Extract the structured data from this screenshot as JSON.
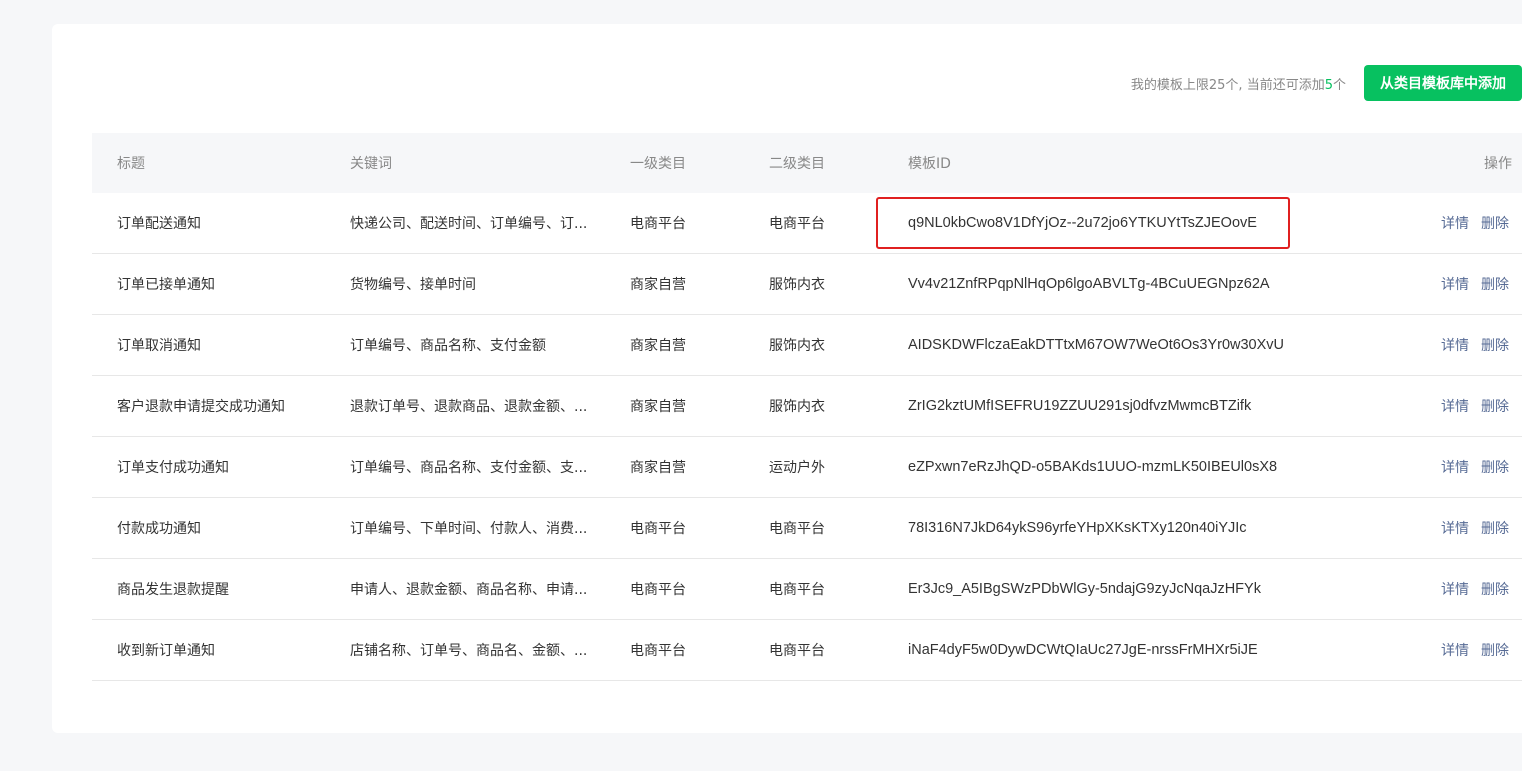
{
  "quota": {
    "prefix": "我的模板上限25个, 当前还可添加",
    "count": "5",
    "suffix": "个"
  },
  "add_button_label": "从类目模板库中添加",
  "columns": {
    "title": "标题",
    "keywords": "关键词",
    "level1": "一级类目",
    "level2": "二级类目",
    "template_id": "模板ID",
    "actions": "操作"
  },
  "rows": [
    {
      "title": "订单配送通知",
      "keywords": "快递公司、配送时间、订单编号、订...",
      "level1": "电商平台",
      "level2": "电商平台",
      "template_id": "q9NL0kbCwo8V1DfYjOz--2u72jo6YTKUYtTsZJEOovE",
      "detail": "详情",
      "delete": "删除"
    },
    {
      "title": "订单已接单通知",
      "keywords": "货物编号、接单时间",
      "level1": "商家自营",
      "level2": "服饰内衣",
      "template_id": "Vv4v21ZnfRPqpNlHqOp6lgoABVLTg-4BCuUEGNpz62A",
      "detail": "详情",
      "delete": "删除"
    },
    {
      "title": "订单取消通知",
      "keywords": "订单编号、商品名称、支付金额",
      "level1": "商家自营",
      "level2": "服饰内衣",
      "template_id": "AIDSKDWFlczaEakDTTtxM67OW7WeOt6Os3Yr0w30XvU",
      "detail": "详情",
      "delete": "删除"
    },
    {
      "title": "客户退款申请提交成功通知",
      "keywords": "退款订单号、退款商品、退款金额、...",
      "level1": "商家自营",
      "level2": "服饰内衣",
      "template_id": "ZrIG2kztUMfISEFRU19ZZUU291sj0dfvzMwmcBTZifk",
      "detail": "详情",
      "delete": "删除"
    },
    {
      "title": "订单支付成功通知",
      "keywords": "订单编号、商品名称、支付金额、支...",
      "level1": "商家自营",
      "level2": "运动户外",
      "template_id": "eZPxwn7eRzJhQD-o5BAKds1UUO-mzmLK50IBEUl0sX8",
      "detail": "详情",
      "delete": "删除"
    },
    {
      "title": "付款成功通知",
      "keywords": "订单编号、下单时间、付款人、消费...",
      "level1": "电商平台",
      "level2": "电商平台",
      "template_id": "78I316N7JkD64ykS96yrfeYHpXKsKTXy120n40iYJIc",
      "detail": "详情",
      "delete": "删除"
    },
    {
      "title": "商品发生退款提醒",
      "keywords": "申请人、退款金额、商品名称、申请...",
      "level1": "电商平台",
      "level2": "电商平台",
      "template_id": "Er3Jc9_A5IBgSWzPDbWlGy-5ndajG9zyJcNqaJzHFYk",
      "detail": "详情",
      "delete": "删除"
    },
    {
      "title": "收到新订单通知",
      "keywords": "店铺名称、订单号、商品名、金额、...",
      "level1": "电商平台",
      "level2": "电商平台",
      "template_id": "iNaF4dyF5w0DywDCWtQIaUc27JgE-nrssFrMHXr5iJE",
      "detail": "详情",
      "delete": "删除"
    }
  ],
  "colors": {
    "accent": "#07c160",
    "link": "#576b95",
    "highlight": "#e02020"
  }
}
